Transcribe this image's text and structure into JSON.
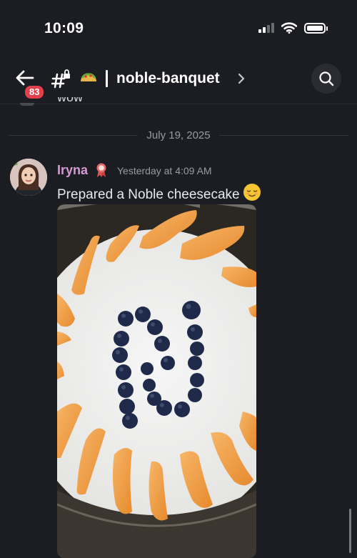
{
  "status_bar": {
    "time": "10:09",
    "icons": [
      "signal-icon",
      "wifi-icon",
      "battery-icon"
    ]
  },
  "header": {
    "back_badge_count": "83",
    "channel_icons": [
      "hash-lock-icon",
      "taco-icon"
    ],
    "channel_name": "noble-banquet",
    "actions": [
      "search-icon"
    ]
  },
  "chat": {
    "previous_message_fragment": "wow",
    "date_separator": "July 19, 2025",
    "message": {
      "author": "Iryna",
      "author_color": "#d89ad4",
      "role_icon": "ribbon-icon",
      "timestamp": "Yesterday at 4:09 AM",
      "text": "Prepared a Noble cheesecake",
      "emoji": "relieved-face-emoji",
      "attachment": "cheesecake-photo"
    }
  },
  "colors": {
    "background": "#1c1d22",
    "badge": "#e2404a",
    "muted_text": "#9a9ba2"
  }
}
